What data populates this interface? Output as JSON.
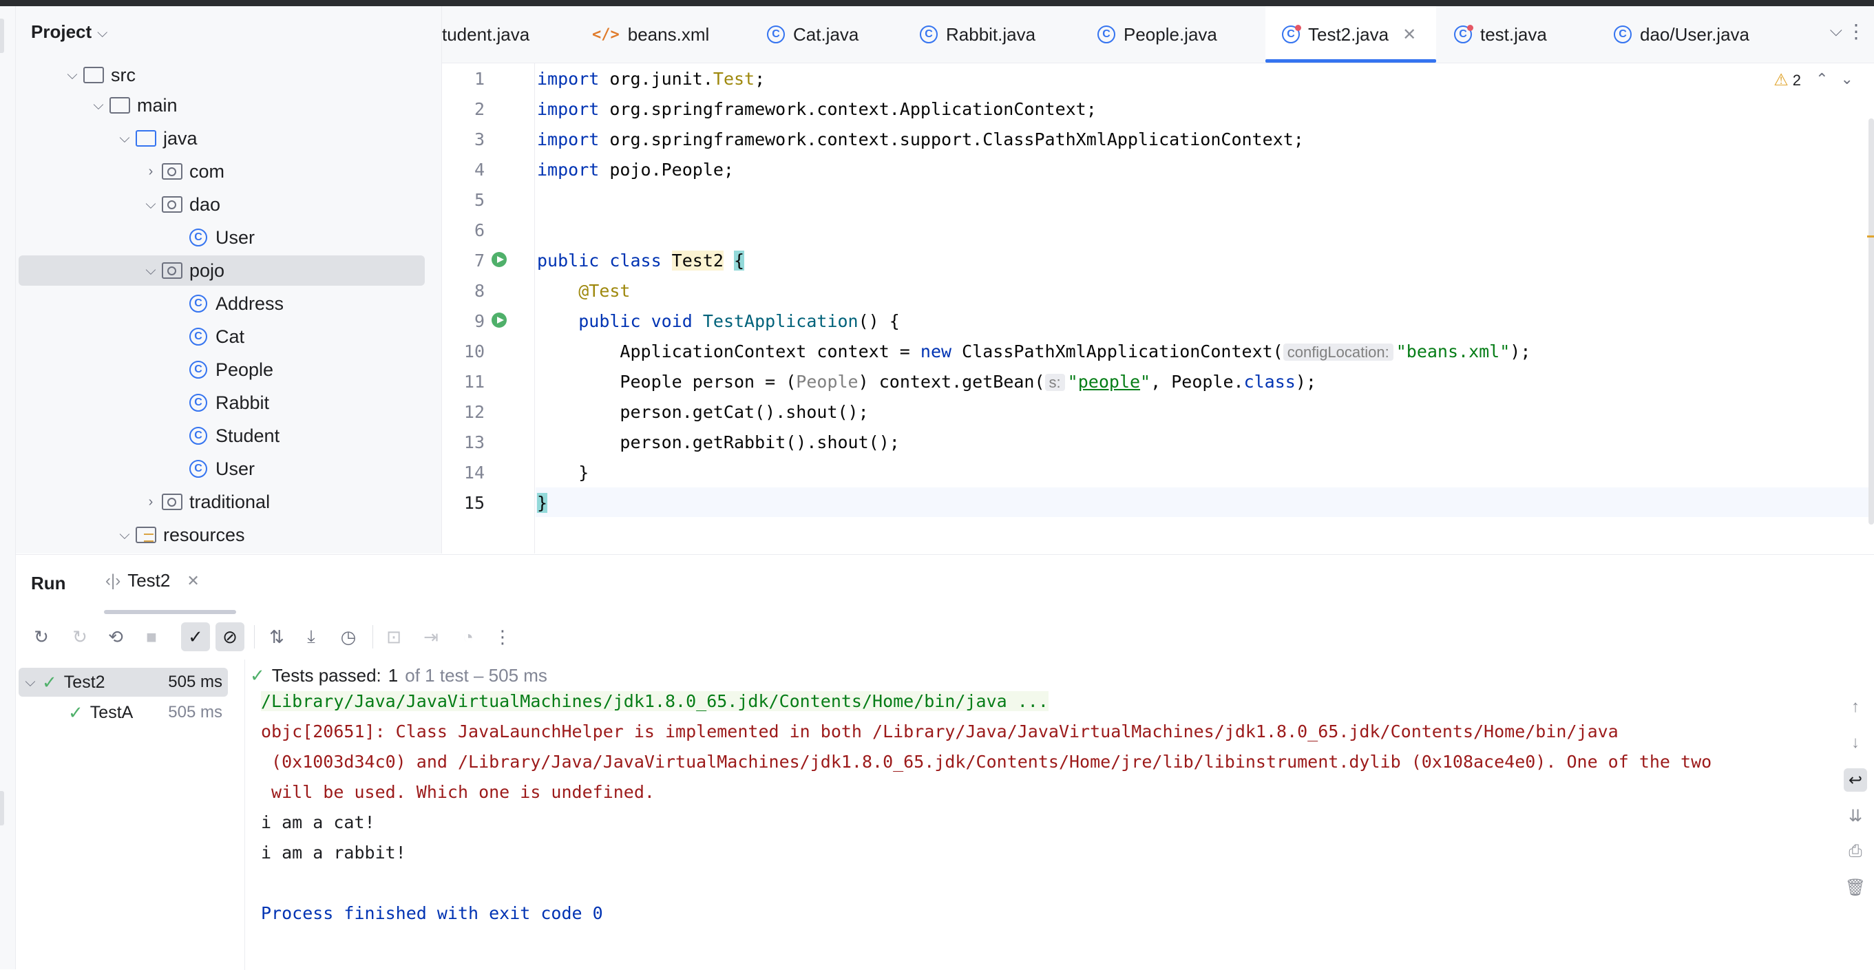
{
  "project": {
    "title": "Project",
    "tree": [
      {
        "label": "src",
        "level": 1,
        "arrow": "open",
        "icon": "folder"
      },
      {
        "label": "main",
        "level": 2,
        "arrow": "open",
        "icon": "folder"
      },
      {
        "label": "java",
        "level": 3,
        "arrow": "open",
        "icon": "folder-blue"
      },
      {
        "label": "com",
        "level": 4,
        "arrow": "closed",
        "icon": "package"
      },
      {
        "label": "dao",
        "level": 4,
        "arrow": "open",
        "icon": "package"
      },
      {
        "label": "User",
        "level": 5,
        "arrow": "none",
        "icon": "class"
      },
      {
        "label": "pojo",
        "level": 4,
        "arrow": "open",
        "icon": "package",
        "selected": true
      },
      {
        "label": "Address",
        "level": 5,
        "arrow": "none",
        "icon": "class"
      },
      {
        "label": "Cat",
        "level": 5,
        "arrow": "none",
        "icon": "class"
      },
      {
        "label": "People",
        "level": 5,
        "arrow": "none",
        "icon": "class"
      },
      {
        "label": "Rabbit",
        "level": 5,
        "arrow": "none",
        "icon": "class"
      },
      {
        "label": "Student",
        "level": 5,
        "arrow": "none",
        "icon": "class"
      },
      {
        "label": "User",
        "level": 5,
        "arrow": "none",
        "icon": "class"
      },
      {
        "label": "traditional",
        "level": 4,
        "arrow": "closed",
        "icon": "package"
      },
      {
        "label": "resources",
        "level": 3,
        "arrow": "open",
        "icon": "resources"
      }
    ]
  },
  "tabs": [
    {
      "label": "tudent.java",
      "icon": "class"
    },
    {
      "label": "beans.xml",
      "icon": "xml"
    },
    {
      "label": "Cat.java",
      "icon": "class"
    },
    {
      "label": "Rabbit.java",
      "icon": "class"
    },
    {
      "label": "People.java",
      "icon": "class"
    },
    {
      "label": "Test2.java",
      "icon": "test",
      "active": true
    },
    {
      "label": "test.java",
      "icon": "test"
    },
    {
      "label": "dao/User.java",
      "icon": "class"
    }
  ],
  "editor": {
    "line_numbers": [
      "1",
      "2",
      "3",
      "4",
      "5",
      "6",
      "7",
      "8",
      "9",
      "10",
      "11",
      "12",
      "13",
      "14",
      "15"
    ],
    "warning_count": "2",
    "code": {
      "l1_kw": "import",
      "l1_rest": " org.junit.",
      "l1_ann": "Test",
      "l1_end": ";",
      "l2_kw": "import",
      "l2_rest": " org.springframework.context.ApplicationContext;",
      "l3_kw": "import",
      "l3_rest": " org.springframework.context.support.ClassPathXmlApplicationContext;",
      "l4_kw": "import",
      "l4_rest": " pojo.People;",
      "l7_kw": "public class ",
      "l7_name": "Test2",
      "l7_brace": "{",
      "l8_ann": "@Test",
      "l9_kw": "public void ",
      "l9_name": "TestApplication",
      "l9_rest": "() {",
      "l10_a": "ApplicationContext context = ",
      "l10_new": "new",
      "l10_b": " ClassPathXmlApplicationContext(",
      "l10_hint": "configLocation:",
      "l10_str": "\"beans.xml\"",
      "l10_end": ");",
      "l11_a": "People person = (",
      "l11_cast": "People",
      "l11_b": ") context.getBean(",
      "l11_hint": "s:",
      "l11_q1": "\"",
      "l11_str": "people",
      "l11_q2": "\"",
      "l11_c": ", People.",
      "l11_cls": "class",
      "l11_end": ");",
      "l12": "person.getCat().shout();",
      "l13": "person.getRabbit().shout();",
      "l14": "}",
      "l15": "}"
    }
  },
  "run": {
    "title": "Run",
    "tab_label": "Test2",
    "tests": [
      {
        "name": "Test2",
        "time": "505 ms"
      },
      {
        "name": "TestA",
        "time": "505 ms"
      }
    ],
    "status_label": "Tests passed:",
    "status_count": "1",
    "status_rest": "of 1 test – 505 ms",
    "console": [
      {
        "type": "cmd",
        "text": "/Library/Java/JavaVirtualMachines/jdk1.8.0_65.jdk/Contents/Home/bin/java ..."
      },
      {
        "type": "err",
        "text": "objc[20651]: Class JavaLaunchHelper is implemented in both /Library/Java/JavaVirtualMachines/jdk1.8.0_65.jdk/Contents/Home/bin/java"
      },
      {
        "type": "err",
        "text": " (0x1003d34c0) and /Library/Java/JavaVirtualMachines/jdk1.8.0_65.jdk/Contents/Home/jre/lib/libinstrument.dylib (0x108ace4e0). One of the two"
      },
      {
        "type": "err",
        "text": " will be used. Which one is undefined."
      },
      {
        "type": "out",
        "text": "i am a cat!"
      },
      {
        "type": "out",
        "text": "i am a rabbit!"
      },
      {
        "type": "out",
        "text": ""
      },
      {
        "type": "fin",
        "text": "Process finished with exit code 0"
      }
    ]
  }
}
